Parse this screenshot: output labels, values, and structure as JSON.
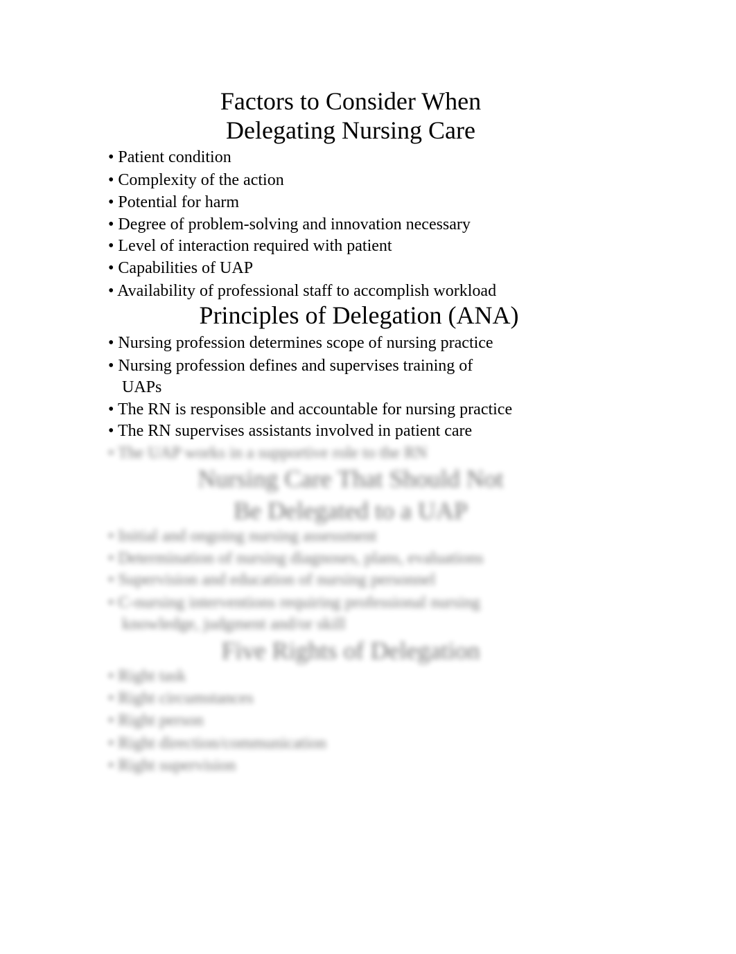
{
  "document": {
    "section1": {
      "title_line1": "Factors to Consider When",
      "title_line2": "Delegating Nursing Care",
      "items": [
        "• Patient condition",
        "• Complexity of the action",
        "• Potential for harm",
        "• Degree of problem-solving and innovation necessary",
        "• Level of interaction required with patient",
        "• Capabilities of UAP",
        "• Availability of professional staff to accomplish workload"
      ]
    },
    "section2": {
      "title": "Principles of Delegation (ANA)",
      "items": [
        "• Nursing profession determines scope of nursing practice",
        "• Nursing profession defines and supervises training of",
        "UAPs",
        "• The RN is responsible and accountable for nursing practice",
        "• The RN supervises assistants involved in patient care",
        "• The UAP works in a supportive role to the RN"
      ]
    },
    "section3": {
      "title_line1": "Nursing Care That Should Not",
      "title_line2": "Be Delegated to a UAP",
      "items": [
        "• Initial and ongoing nursing assessment",
        "• Determination of nursing diagnoses, plans, evaluations",
        "• Supervision and education of nursing personnel",
        "• C-nursing interventions requiring professional nursing",
        "knowledge, judgment and/or skill"
      ]
    },
    "section4": {
      "title": "Five Rights of Delegation",
      "items": [
        "• Right task",
        "• Right circumstances",
        "• Right person",
        "• Right direction/communication",
        "• Right supervision"
      ]
    }
  }
}
